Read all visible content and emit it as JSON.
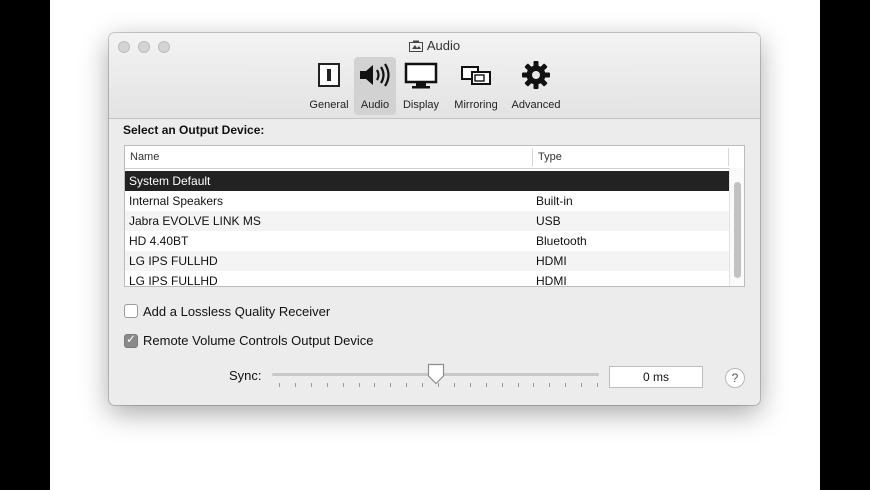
{
  "window": {
    "title": "Audio"
  },
  "toolbar": {
    "items": [
      {
        "label": "General",
        "icon": "general-icon"
      },
      {
        "label": "Audio",
        "icon": "speaker-icon",
        "selected": true
      },
      {
        "label": "Display",
        "icon": "display-icon"
      },
      {
        "label": "Mirroring",
        "icon": "mirroring-icon"
      },
      {
        "label": "Advanced",
        "icon": "gear-icon"
      }
    ]
  },
  "output": {
    "section_label": "Select an Output Device:",
    "columns": {
      "name": "Name",
      "type": "Type"
    },
    "rows": [
      {
        "name": "System Default",
        "type": "",
        "selected": true
      },
      {
        "name": "Internal Speakers",
        "type": "Built-in"
      },
      {
        "name": "Jabra EVOLVE LINK MS",
        "type": "USB"
      },
      {
        "name": "HD 4.40BT",
        "type": "Bluetooth"
      },
      {
        "name": "LG IPS FULLHD",
        "type": "HDMI"
      },
      {
        "name": "LG IPS FULLHD",
        "type": "HDMI"
      }
    ]
  },
  "options": {
    "lossless_label": "Add a Lossless Quality Receiver",
    "lossless_checked": false,
    "remote_volume_label": "Remote Volume Controls Output Device",
    "remote_volume_checked": true
  },
  "sync": {
    "label": "Sync:",
    "value": "0 ms",
    "slider_position": 0.5
  },
  "help": {
    "label": "?"
  }
}
